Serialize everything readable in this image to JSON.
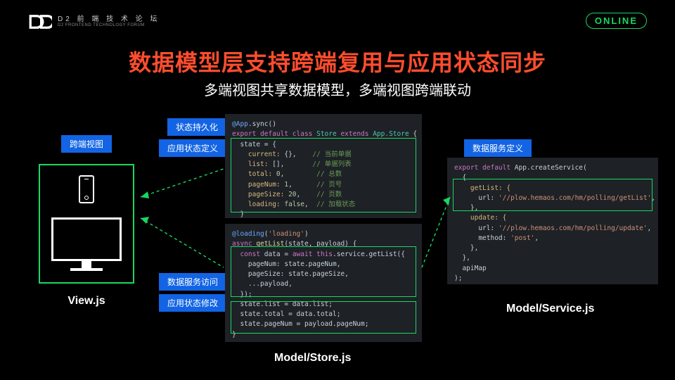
{
  "header": {
    "logo_cn": "D2 前 端 技 术 论 坛",
    "logo_en": "D2 FRONTEND TECHNOLOGY FORUM",
    "badge": "ONLINE"
  },
  "title": "数据模型层支持跨端复用与应用状态同步",
  "subtitle": "多端视图共享数据模型，多端视图跨端联动",
  "tags": {
    "cross_end_view": "跨端视图",
    "state_persist": "状态持久化",
    "app_state_def": "应用状态定义",
    "data_service_access": "数据服务访问",
    "app_state_modify": "应用状态修改",
    "data_service_def": "数据服务定义"
  },
  "labels": {
    "view": "View.js",
    "store": "Model/Store.js",
    "service": "Model/Service.js"
  },
  "code": {
    "store_top": {
      "l1a": "@App",
      "l1b": ".sync()",
      "l2a": "export default class ",
      "l2b": "Store",
      "l2c": " extends ",
      "l2d": "App.Store",
      "l2e": " {",
      "l3": "  state = {",
      "l4a": "    current: ",
      "l4b": "{}",
      "l4c": ",    ",
      "l4d": "// 当前单据",
      "l5a": "    list: ",
      "l5b": "[]",
      "l5c": ",       ",
      "l5d": "// 单据列表",
      "l6a": "    total: ",
      "l6b": "0",
      "l6c": ",        ",
      "l6d": "// 总数",
      "l7a": "    pageNum: ",
      "l7b": "1",
      "l7c": ",      ",
      "l7d": "// 页号",
      "l8a": "    pageSize: ",
      "l8b": "20",
      "l8c": ",    ",
      "l8d": "// 页数",
      "l9a": "    loading: ",
      "l9b": "false",
      "l9c": ",  ",
      "l9d": "// 加载状态",
      "l10": "  }"
    },
    "store_bot": {
      "l1a": "@loading",
      "l1b": "(",
      "l1c": "'loading'",
      "l1d": ")",
      "l2a": "async ",
      "l2b": "getList",
      "l2c": "(state, payload) {",
      "l3a": "  const ",
      "l3b": "data",
      "l3c": " = ",
      "l3d": "await this",
      "l3e": ".service.getList({",
      "l4": "    pageNum: state.pageNum,",
      "l5": "    pageSize: state.pageSize,",
      "l6": "    ...payload,",
      "l7": "  });",
      "l8": "  state.list = data.list;",
      "l9": "  state.total = data.total;",
      "l10": "  state.pageNum = payload.pageNum;",
      "l11": "}"
    },
    "service": {
      "l1a": "export default ",
      "l1b": "App.createService(",
      "l2": "  {",
      "l3": "    getList: {",
      "l4a": "      url: ",
      "l4b": "'//plow.hemaos.com/hm/polling/getList'",
      "l4c": ",",
      "l5": "    },",
      "l6": "    update: {",
      "l7a": "      url: ",
      "l7b": "'//plow.hemaos.com/hm/polling/update'",
      "l7c": ",",
      "l8a": "      method: ",
      "l8b": "'post'",
      "l8c": ",",
      "l9": "    },",
      "l10": "  },",
      "l11": "  apiMap",
      "l12": ");"
    }
  }
}
